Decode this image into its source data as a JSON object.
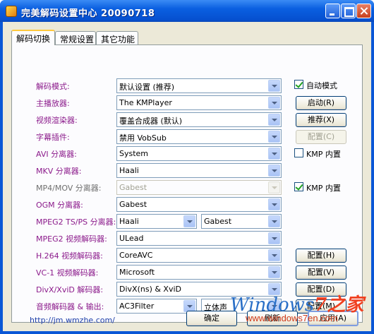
{
  "window": {
    "title": "完美解码设置中心  20090718"
  },
  "tabs": [
    {
      "label": "解码切换",
      "active": true
    },
    {
      "label": "常规设置",
      "active": false
    },
    {
      "label": "其它功能",
      "active": false
    }
  ],
  "rows": [
    {
      "label": "解码模式:",
      "value": "默认设置 (推荐)"
    },
    {
      "label": "主播放器:",
      "value": "The KMPlayer"
    },
    {
      "label": "视频渲染器:",
      "value": "覆盖合成器 (默认)"
    },
    {
      "label": "字幕插件:",
      "value": "禁用 VobSub"
    },
    {
      "label": "AVI 分离器:",
      "value": "System"
    },
    {
      "label": "MKV 分离器:",
      "value": "Haali"
    },
    {
      "label": "MP4/MOV 分离器:",
      "value": "Gabest",
      "disabled": true
    },
    {
      "label": "OGM 分离器:",
      "value": "Gabest"
    },
    {
      "label": "MPEG2 TS/PS 分离器:",
      "value": "Haali",
      "value2": "Gabest"
    },
    {
      "label": "MPEG2 视频解码器:",
      "value": "ULead"
    },
    {
      "label": "H.264 视频解码器:",
      "value": "CoreAVC"
    },
    {
      "label": "VC-1 视频解码器:",
      "value": "Microsoft"
    },
    {
      "label": "DivX/XviD 解码器:",
      "value": "DivX(ns) & XviD"
    },
    {
      "label": "音频解码器 & 输出:",
      "value": "AC3Filter",
      "value2": "立体声"
    }
  ],
  "side": {
    "auto_mode": {
      "label": "自动模式",
      "checked": true
    },
    "start_btn": "启动(R)",
    "recommend_btn": "推荐(X)",
    "config_c_btn": "配置(C)",
    "kmp_builtin_1": {
      "label": "KMP 内置",
      "checked": false
    },
    "kmp_builtin_2": {
      "label": "KMP 内置",
      "checked": true
    },
    "config_h_btn": "配置(H)",
    "config_v_btn": "配置(V)",
    "config_d_btn": "配置(D)",
    "config_m_btn": "配置(M)"
  },
  "footer": {
    "link": "http://jm.wmzhe.com/",
    "ok": "确定",
    "refresh": "刷新",
    "apply": "应用(A)"
  },
  "watermark": {
    "brand_a": "Windows",
    "brand_b": "7之家",
    "url": "www.windows7en.com"
  }
}
